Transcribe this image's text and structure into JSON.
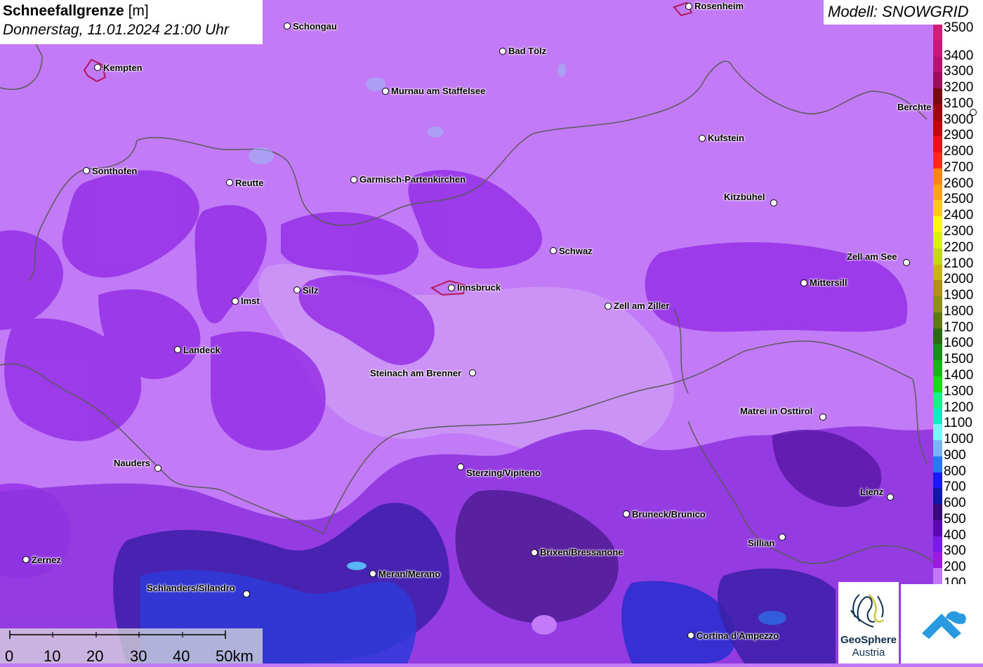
{
  "title": {
    "main": "Schneefallgrenze",
    "unit": "[m]",
    "date": "Donnerstag, 11.01.2024 21:00 Uhr"
  },
  "model_label": "Modell: SNOWGRID",
  "legend": {
    "items": [
      {
        "label": "3500",
        "color": "#d01e78"
      },
      {
        "label": "3400",
        "color": "#c7187a"
      },
      {
        "label": "3300",
        "color": "#b8126f"
      },
      {
        "label": "3200",
        "color": "#9c0e5c"
      },
      {
        "label": "3100",
        "color": "#7a0a12"
      },
      {
        "label": "3000",
        "color": "#a00810"
      },
      {
        "label": "2900",
        "color": "#c20a0e"
      },
      {
        "label": "2800",
        "color": "#e4141a"
      },
      {
        "label": "2700",
        "color": "#ff2a1a"
      },
      {
        "label": "2600",
        "color": "#ff8418"
      },
      {
        "label": "2500",
        "color": "#ffa41a"
      },
      {
        "label": "2400",
        "color": "#ffc81c"
      },
      {
        "label": "2300",
        "color": "#fff51a"
      },
      {
        "label": "2200",
        "color": "#d8f018"
      },
      {
        "label": "2100",
        "color": "#c4d818"
      },
      {
        "label": "2000",
        "color": "#c7b419"
      },
      {
        "label": "1900",
        "color": "#b0901a"
      },
      {
        "label": "1800",
        "color": "#8e8e1a"
      },
      {
        "label": "1700",
        "color": "#5e7a10"
      },
      {
        "label": "1600",
        "color": "#2a6a14"
      },
      {
        "label": "1500",
        "color": "#1a8e1a"
      },
      {
        "label": "1400",
        "color": "#1ab41a"
      },
      {
        "label": "1300",
        "color": "#1ad81a"
      },
      {
        "label": "1200",
        "color": "#1af08a"
      },
      {
        "label": "1100",
        "color": "#1ae8c4"
      },
      {
        "label": "1000",
        "color": "#7af5f5"
      },
      {
        "label": "900",
        "color": "#7ab4f5"
      },
      {
        "label": "800",
        "color": "#2a78f0"
      },
      {
        "label": "700",
        "color": "#1a1af0"
      },
      {
        "label": "600",
        "color": "#1018a8"
      },
      {
        "label": "500",
        "color": "#3a0a78"
      },
      {
        "label": "400",
        "color": "#5a0ab0"
      },
      {
        "label": "300",
        "color": "#7a1ae8"
      },
      {
        "label": "200",
        "color": "#9a1ae0"
      },
      {
        "label": "100",
        "color": "#c078f5"
      }
    ]
  },
  "cities": [
    {
      "name": "Rosenheim"
    },
    {
      "name": "Schongau"
    },
    {
      "name": "Bad Tölz"
    },
    {
      "name": "Kempten"
    },
    {
      "name": "Murnau am Staffelsee"
    },
    {
      "name": "Berchte"
    },
    {
      "name": "Kufstein"
    },
    {
      "name": "Sonthofen"
    },
    {
      "name": "Reutte"
    },
    {
      "name": "Garmisch-Partenkirchen"
    },
    {
      "name": "Kitzbühel"
    },
    {
      "name": "Schwaz"
    },
    {
      "name": "Zell am See"
    },
    {
      "name": "Mittersill"
    },
    {
      "name": "Imst"
    },
    {
      "name": "Silz"
    },
    {
      "name": "Innsbruck"
    },
    {
      "name": "Zell am Ziller"
    },
    {
      "name": "Landeck"
    },
    {
      "name": "Steinach am Brenner"
    },
    {
      "name": "Matrei in Osttirol"
    },
    {
      "name": "Nauders"
    },
    {
      "name": "Sterzing/Vipiteno"
    },
    {
      "name": "Lienz"
    },
    {
      "name": "Bruneck/Brunico"
    },
    {
      "name": "Sillian"
    },
    {
      "name": "Brixen/Bressanone"
    },
    {
      "name": "Zernez"
    },
    {
      "name": "Meran/Merano"
    },
    {
      "name": "Schlanders/Silandro"
    },
    {
      "name": "Cortina d'Ampezzo"
    }
  ],
  "scale": {
    "labels": [
      "0",
      "10",
      "20",
      "30",
      "40",
      "50km"
    ]
  },
  "logos": {
    "geosphere_line1": "GeoSphere",
    "geosphere_line2": "Austria"
  },
  "colors": {
    "base_snowline": "#c178f5",
    "level_200": "#9a2ee6",
    "level_300": "#7a3ae8",
    "level_400": "#5a1aa8",
    "level_600": "#2a3ad8",
    "low_zone": "#3a1a90",
    "terrain_light": "#d9b6f7",
    "border": "#555555"
  }
}
